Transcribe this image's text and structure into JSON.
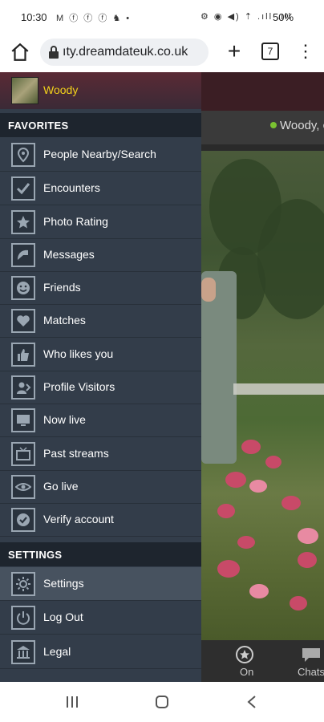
{
  "status_bar": {
    "time": "10:30",
    "notification_icons": "M ⓕ ⓕ ⓕ ♞ •",
    "system_icons": "⚙ ◉ ◀) ⇡ .ıll .ıll",
    "battery": "50%"
  },
  "browser": {
    "url": "ıty.dreamdateuk.co.uk",
    "tab_count": "7"
  },
  "drawer": {
    "user_name": "Woody",
    "favorites_heading": "FAVORITES",
    "settings_heading": "SETTINGS",
    "favorites": [
      {
        "label": "People Nearby/Search",
        "icon": "location-pin-icon"
      },
      {
        "label": "Encounters",
        "icon": "checkmark-icon"
      },
      {
        "label": "Photo Rating",
        "icon": "star-icon"
      },
      {
        "label": "Messages",
        "icon": "message-icon"
      },
      {
        "label": "Friends",
        "icon": "smiley-icon"
      },
      {
        "label": "Matches",
        "icon": "heart-icon"
      },
      {
        "label": "Who likes you",
        "icon": "thumbs-up-icon"
      },
      {
        "label": "Profile Visitors",
        "icon": "visitor-icon"
      },
      {
        "label": "Now live",
        "icon": "monitor-icon"
      },
      {
        "label": "Past streams",
        "icon": "tv-icon"
      },
      {
        "label": "Go live",
        "icon": "eye-icon"
      },
      {
        "label": "Verify account",
        "icon": "verified-check-icon"
      }
    ],
    "settings": [
      {
        "label": "Settings",
        "icon": "gear-icon"
      },
      {
        "label": "Log Out",
        "icon": "power-icon"
      },
      {
        "label": "Legal",
        "icon": "courthouse-icon"
      }
    ]
  },
  "background_page": {
    "user_greeting": "Woody, c",
    "tabs": [
      {
        "label": "On",
        "icon": "star-circle-icon"
      },
      {
        "label": "Chats",
        "icon": "chat-bubble-icon"
      }
    ]
  },
  "colors": {
    "drawer_bg": "#333d4a",
    "section_bg": "#1e252e",
    "username": "#f2d21b",
    "online_dot": "#7ac231"
  }
}
